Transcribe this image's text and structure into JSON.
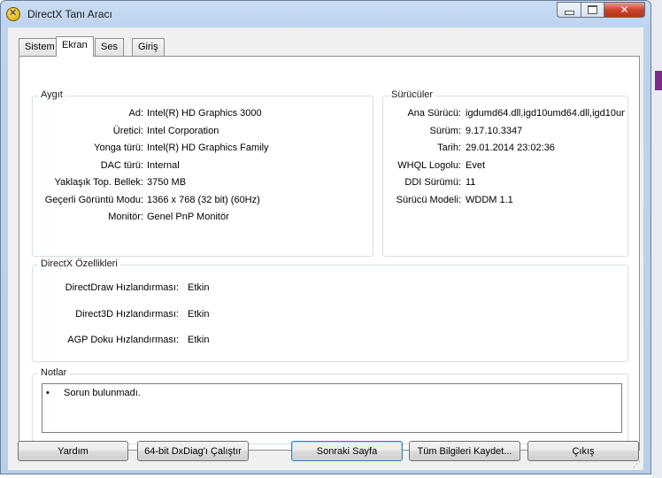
{
  "window": {
    "title": "DirectX Tanı Aracı"
  },
  "tabs": [
    "Sistem",
    "Ekran",
    "Ses",
    "Giriş"
  ],
  "active_tab": "Ekran",
  "device": {
    "title": "Aygıt",
    "rows": [
      {
        "label": "Ad:",
        "value": "Intel(R) HD Graphics 3000"
      },
      {
        "label": "Üretici:",
        "value": "Intel Corporation"
      },
      {
        "label": "Yonga türü:",
        "value": "Intel(R) HD Graphics Family"
      },
      {
        "label": "DAC türü:",
        "value": "Internal"
      },
      {
        "label": "Yaklaşık Top. Bellek:",
        "value": "3750 MB"
      },
      {
        "label": "Geçerli Görüntü Modu:",
        "value": "1366 x 768 (32 bit) (60Hz)"
      },
      {
        "label": "Monitör:",
        "value": "Genel PnP Monitör"
      }
    ]
  },
  "drivers": {
    "title": "Sürücüler",
    "rows": [
      {
        "label": "Ana Sürücü:",
        "value": "igdumd64.dll,igd10umd64.dll,igd10um"
      },
      {
        "label": "Sürüm:",
        "value": "9.17.10.3347"
      },
      {
        "label": "Tarih:",
        "value": "29.01.2014 23:02:36"
      },
      {
        "label": "WHQL Logolu:",
        "value": "Evet"
      },
      {
        "label": "DDI Sürümü:",
        "value": "11"
      },
      {
        "label": "Sürücü Modeli:",
        "value": "WDDM 1.1"
      }
    ]
  },
  "features": {
    "title": "DirectX Özellikleri",
    "rows": [
      {
        "label": "DirectDraw Hızlandırması:",
        "value": "Etkin"
      },
      {
        "label": "Direct3D Hızlandırması:",
        "value": "Etkin"
      },
      {
        "label": "AGP Doku Hızlandırması:",
        "value": "Etkin"
      }
    ]
  },
  "notes": {
    "title": "Notlar",
    "items": [
      "Sorun bulunmadı."
    ]
  },
  "buttons": {
    "help": "Yardım",
    "run64": "64-bit DxDiag'ı Çalıştır",
    "next": "Sonraki Sayfa",
    "save": "Tüm Bilgileri Kaydet...",
    "exit": "Çıkış"
  }
}
